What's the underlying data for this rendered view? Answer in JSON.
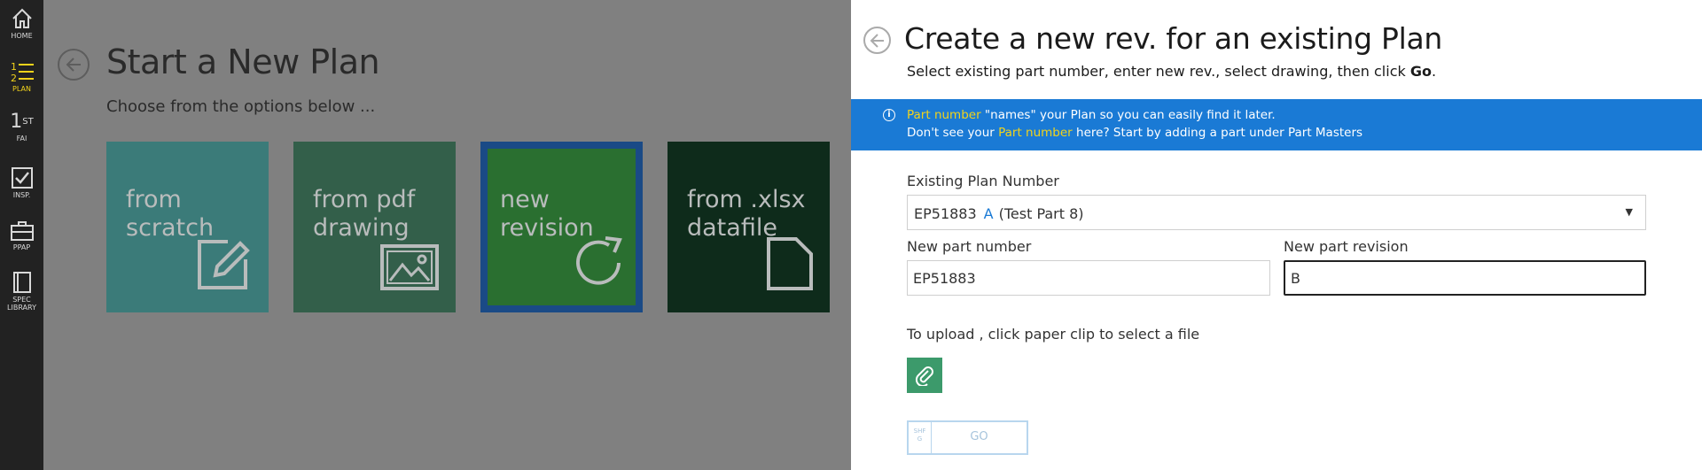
{
  "sidebar": {
    "items": [
      {
        "label": "HOME",
        "icon": "home-icon"
      },
      {
        "label": "PLAN",
        "icon": "numbered-list-icon"
      },
      {
        "label": "FAI",
        "icon": "first-icon",
        "glyph": "1",
        "sup": "ST"
      },
      {
        "label": "INSP.",
        "icon": "checkbox-icon"
      },
      {
        "label": "PPAP",
        "icon": "briefcase-icon"
      },
      {
        "label": "SPEC\nLIBRARY",
        "icon": "book-icon"
      }
    ]
  },
  "left": {
    "title": "Start a New Plan",
    "subtitle": "Choose from the options below ...",
    "tiles": [
      {
        "label": "from\nscratch",
        "icon": "edit-icon"
      },
      {
        "label": "from pdf\ndrawing",
        "icon": "image-icon"
      },
      {
        "label": "new\nrevision",
        "icon": "refresh-icon"
      },
      {
        "label": "from .xlsx\ndatafile",
        "icon": "document-icon"
      }
    ]
  },
  "panel": {
    "title": "Create a new rev. for an existing Plan",
    "subtitle_prefix": "Select existing part number, enter new rev., select drawing, then click ",
    "subtitle_bold": "Go",
    "subtitle_suffix": ".",
    "info": {
      "line1_hl": "Part number",
      "line1_rest": " \"names\" your Plan so you can easily find it later.",
      "line2_pre": "Don't see your ",
      "line2_hl": "Part number",
      "line2_post": " here? Start by adding a part under Part Masters"
    },
    "existing_label": "Existing Plan Number",
    "existing_part": "EP51883",
    "existing_rev": "A",
    "existing_desc": "(Test Part 8)",
    "new_part_label": "New part number",
    "new_part_value": "EP51883",
    "new_rev_label": "New part revision",
    "new_rev_value": "B",
    "upload_text": "To upload , click paper clip to select a file",
    "go_shortcut": "SHF\nG",
    "go_label": "GO"
  },
  "colors": {
    "sidebar_bg": "#222222",
    "active": "#f2d31b",
    "info_bg": "#1a7ad5",
    "clip_btn": "#3c9a6b"
  }
}
